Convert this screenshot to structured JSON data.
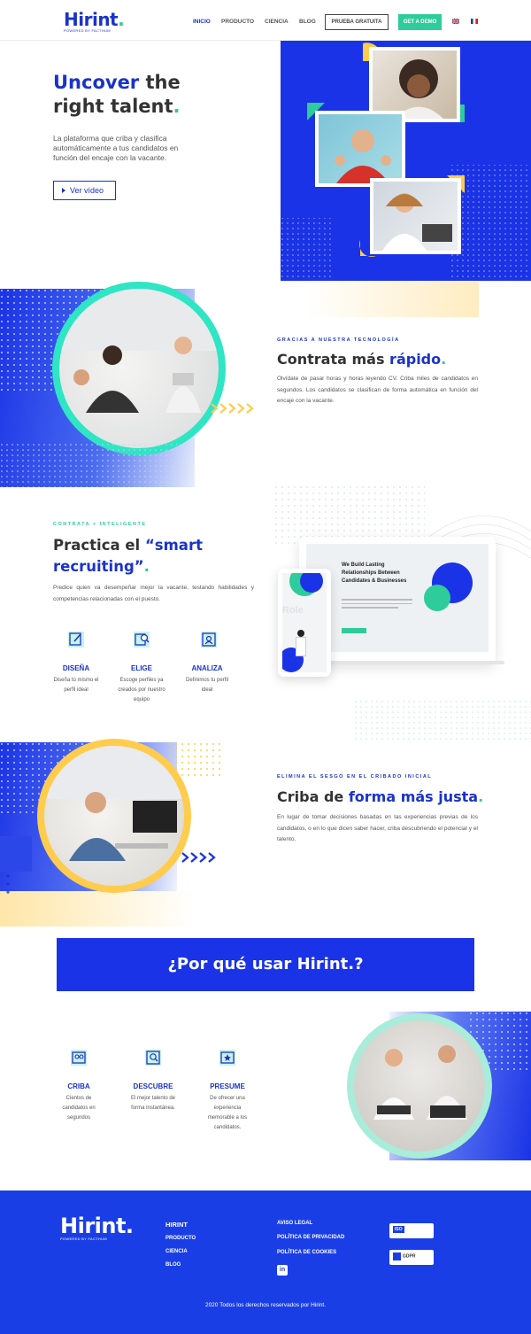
{
  "header": {
    "logo": "Hirint",
    "logo_dot": ".",
    "logo_sub": "POWERED BY FACTHUM",
    "nav": [
      "INICIO",
      "PRODUCTO",
      "CIENCIA",
      "BLOG"
    ],
    "prueba_label": "PRUEBA GRATUITA",
    "demo_label": "GET A DEMO"
  },
  "hero": {
    "title_word1": "Uncover",
    "title_word2": " the",
    "title_line2": "right talent",
    "title_dot": ".",
    "description": "La plataforma que criba y clasifica automáticamente a tus candidatos en función del encaje con la vacante.",
    "video_label": "Ver vídeo"
  },
  "section1": {
    "eyebrow": "GRACIAS A NUESTRA TECNOLOGÍA",
    "title_a": "Contrata más ",
    "title_b": "rápido",
    "title_dot": ".",
    "description": "Olvídate de pasar horas y horas leyendo CV. Criba miles de candidatos en segundos. Los candidatos se clasifican de forma automática en función del encaje con la vacante."
  },
  "section2": {
    "eyebrow": "CONTRATA + INTELIGENTE",
    "title_a": "Practica el ",
    "title_b": "“smart",
    "title_c": "recruiting”",
    "title_dot": ".",
    "description": "Predice quien va desempeñar mejor la vacante, testando habilidades y competencias relacionadas con el puesto.",
    "features": [
      {
        "title": "DISEÑA",
        "desc": "Diseña tú mismo el perfil ideal"
      },
      {
        "title": "ELIGE",
        "desc": "Escoge perfiles ya creados por nuestro equipo"
      },
      {
        "title": "ANALIZA",
        "desc": "Definimos tu perfil ideal"
      }
    ],
    "mockup_heading": "We Build Lasting Relationships Between Candidates & Businesses",
    "mockup_role": "Role"
  },
  "section3": {
    "eyebrow": "ELIMINA EL SESGO EN EL CRIBADO INICIAL",
    "title_a": "Criba de ",
    "title_b": "forma más justa",
    "title_dot": ".",
    "description": "En lugar de tomar decisiones basadas en las experiencias previas de los candidatos, o en lo que dicen saber hacer, criba descubriendo el potencial y el talento."
  },
  "banner": {
    "title": "¿Por qué usar Hirint.?"
  },
  "section4": {
    "features": [
      {
        "title": "CRIBA",
        "desc": "Cientos de candidatos en segundos"
      },
      {
        "title": "DESCUBRE",
        "desc": "El mejor talento de forma instantánea."
      },
      {
        "title": "PRESUME",
        "desc": "De ofrecer una experiencia memorable a los candidatos."
      }
    ]
  },
  "footer": {
    "logo": "Hirint.",
    "logo_sub": "POWERED BY FACTHUM",
    "col1": [
      "HIRINT",
      "PRODUCTO",
      "CIENCIA",
      "BLOG"
    ],
    "col2": [
      "AVISO LEGAL",
      "POLÍTICA DE PRIVACIDAD",
      "POLÍTICA DE COOKIES"
    ],
    "badge1": "ISO",
    "badge2": "GDPR",
    "social": "in",
    "copyright": "2020 Todos los derechos reservados por Hirint."
  },
  "colors": {
    "brand_blue": "#1a33c9",
    "panel_blue": "#1a33e6",
    "teal": "#2ecc9a",
    "yellow": "#ffcc4d"
  }
}
